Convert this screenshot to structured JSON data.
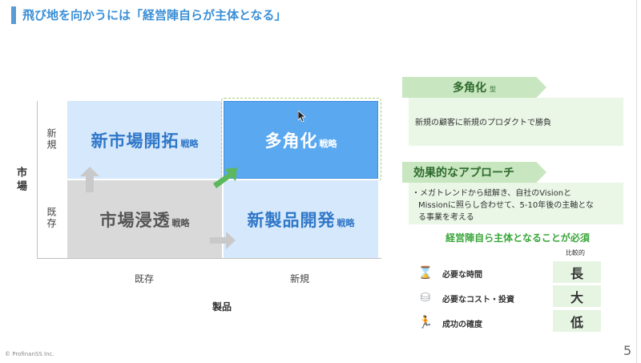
{
  "slide": {
    "title": "飛び地を向かうには「経営陣自らが主体となる」",
    "page_number": "5",
    "copyright": "© ProfinanSS Inc."
  },
  "matrix": {
    "y_axis_title": "市場",
    "x_axis_title": "製品",
    "y_labels": {
      "new": "新規",
      "existing": "既存"
    },
    "x_labels": {
      "existing": "既存",
      "new": "新規"
    },
    "cells": {
      "top_left": {
        "main": "新市場開拓",
        "suffix": "戦略"
      },
      "top_right": {
        "main": "多角化",
        "suffix": "戦略"
      },
      "bottom_left": {
        "main": "市場浸透",
        "suffix": "戦略"
      },
      "bottom_right": {
        "main": "新製品開発",
        "suffix": "戦略"
      }
    }
  },
  "panel": {
    "diversify": {
      "title": "多角化",
      "title_suffix": "型",
      "description": "新規の顧客に新規のプロダクトで勝負"
    },
    "approach": {
      "title": "効果的なアプローチ",
      "bullet_line1": "・メガトレンドから紐解き、自社のVisionと",
      "bullet_line2": "Missionに照らし合わせて、5-10年後の主軸とな",
      "bullet_line3": "る事業を考える"
    },
    "conclusion": "経営陣自ら主体となることが必須",
    "compare_header": "比較的",
    "rows": [
      {
        "label": "必要な時間",
        "value": "長",
        "icon": "hourglass-icon",
        "glyph": "⌛"
      },
      {
        "label": "必要なコスト・投資",
        "value": "大",
        "icon": "coins-icon",
        "glyph": "⛁"
      },
      {
        "label": "成功の確度",
        "value": "低",
        "icon": "runner-icon",
        "glyph": "🏃"
      }
    ]
  },
  "colors": {
    "accent_blue": "#3b8fd6",
    "cell_light_blue": "#d6e8fb",
    "cell_blue": "#5aa8f0",
    "cell_gray": "#d9d9d9",
    "green_header": "#c8e6c0",
    "green_text": "#3aa63a"
  }
}
